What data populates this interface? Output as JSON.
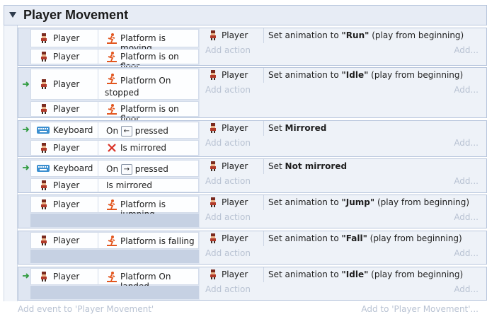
{
  "group": {
    "title": "Player Movement"
  },
  "events": [
    {
      "conditions": [
        {
          "object": "Player",
          "text": "Platform is moving",
          "icon": "platform-behavior-icon"
        },
        {
          "object": "Player",
          "text": "Platform is on floor",
          "icon": "platform-behavior-icon"
        }
      ],
      "action": {
        "object": "Player",
        "pre": "Set animation to ",
        "bold": "\"Run\"",
        "post": " (play from beginning)"
      }
    },
    {
      "conditions": [
        {
          "object": "Player",
          "text": "Platform On stopped",
          "icon": "platform-behavior-icon"
        },
        {
          "object": "Player",
          "text": "Platform is on floor",
          "icon": "platform-behavior-icon"
        }
      ],
      "action": {
        "object": "Player",
        "pre": "Set animation to ",
        "bold": "\"Idle\"",
        "post": " (play from beginning)"
      }
    },
    {
      "conditions": [
        {
          "object": "Keyboard",
          "pre": "On ",
          "key": "←",
          "post": " pressed",
          "icon": "keyboard-icon"
        },
        {
          "object": "Player",
          "text": "Is mirrored",
          "icon": "inverted-x-icon"
        }
      ],
      "action": {
        "object": "Player",
        "pre": "Set ",
        "bold": "Mirrored",
        "post": ""
      }
    },
    {
      "conditions": [
        {
          "object": "Keyboard",
          "pre": "On ",
          "key": "→",
          "post": " pressed",
          "icon": "keyboard-icon"
        },
        {
          "object": "Player",
          "text": "Is mirrored",
          "icon": "none"
        }
      ],
      "action": {
        "object": "Player",
        "pre": "Set ",
        "bold": "Not mirrored",
        "post": ""
      }
    },
    {
      "conditions": [
        {
          "object": "Player",
          "text": "Platform is jumping",
          "icon": "platform-behavior-icon"
        }
      ],
      "action": {
        "object": "Player",
        "pre": "Set animation to ",
        "bold": "\"Jump\"",
        "post": " (play from beginning)"
      }
    },
    {
      "conditions": [
        {
          "object": "Player",
          "text": "Platform is falling",
          "icon": "platform-behavior-icon"
        }
      ],
      "action": {
        "object": "Player",
        "pre": "Set animation to ",
        "bold": "\"Fall\"",
        "post": " (play from beginning)"
      }
    },
    {
      "conditions": [
        {
          "object": "Player",
          "text": "Platform On landed",
          "icon": "platform-behavior-icon"
        }
      ],
      "action": {
        "object": "Player",
        "pre": "Set animation to ",
        "bold": "\"Idle\"",
        "post": " (play from beginning)"
      }
    }
  ],
  "labels": {
    "add_action": "Add action",
    "add_more": "Add...",
    "add_event": "Add event to 'Player Movement'",
    "add_to_group": "Add to 'Player Movement'..."
  },
  "colors": {
    "accent_green": "#2e9a3e",
    "platform_orange": "#e2561f",
    "header_bg": "#e7ecf5",
    "row_border": "#b7c5dc"
  }
}
